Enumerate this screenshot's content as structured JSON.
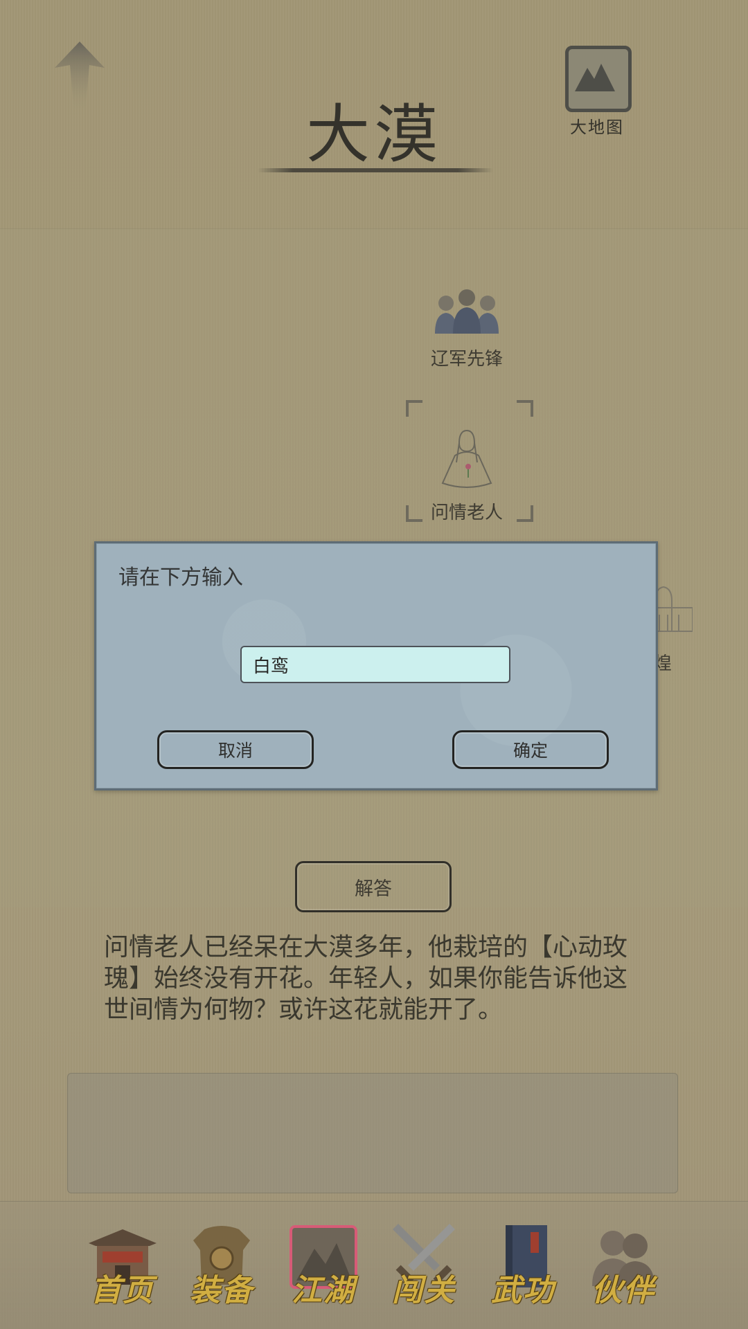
{
  "header": {
    "title": "大漠",
    "map_label": "大地图"
  },
  "map": {
    "nodes": [
      {
        "name": "辽军先锋",
        "icon": "soldiers-icon"
      },
      {
        "name": "问情老人",
        "icon": "old-man-icon"
      },
      {
        "name": "煌",
        "icon": "temple-icon"
      }
    ]
  },
  "dialog": {
    "title": "请在下方输入",
    "input_value": "白鸾",
    "cancel_label": "取消",
    "confirm_label": "确定"
  },
  "answer_label": "解答",
  "story_text": "问情老人已经呆在大漠多年，他栽培的【心动玫瑰】始终没有开花。年轻人，如果你能告诉他这世间情为何物？或许这花就能开了。",
  "bottom_nav": [
    {
      "label": "首页",
      "icon": "house-icon"
    },
    {
      "label": "装备",
      "icon": "armor-icon"
    },
    {
      "label": "江湖",
      "icon": "mountain-scroll-icon",
      "active": true
    },
    {
      "label": "闯关",
      "icon": "crossed-swords-icon"
    },
    {
      "label": "武功",
      "icon": "book-icon"
    },
    {
      "label": "伙伴",
      "icon": "partners-icon"
    }
  ],
  "colors": {
    "background": "#a89b7a",
    "dialog_bg": "#a3b7c5",
    "input_bg": "#d4fbfb",
    "nav_label": "#d9b441",
    "active_glow": "#e05a7a"
  }
}
